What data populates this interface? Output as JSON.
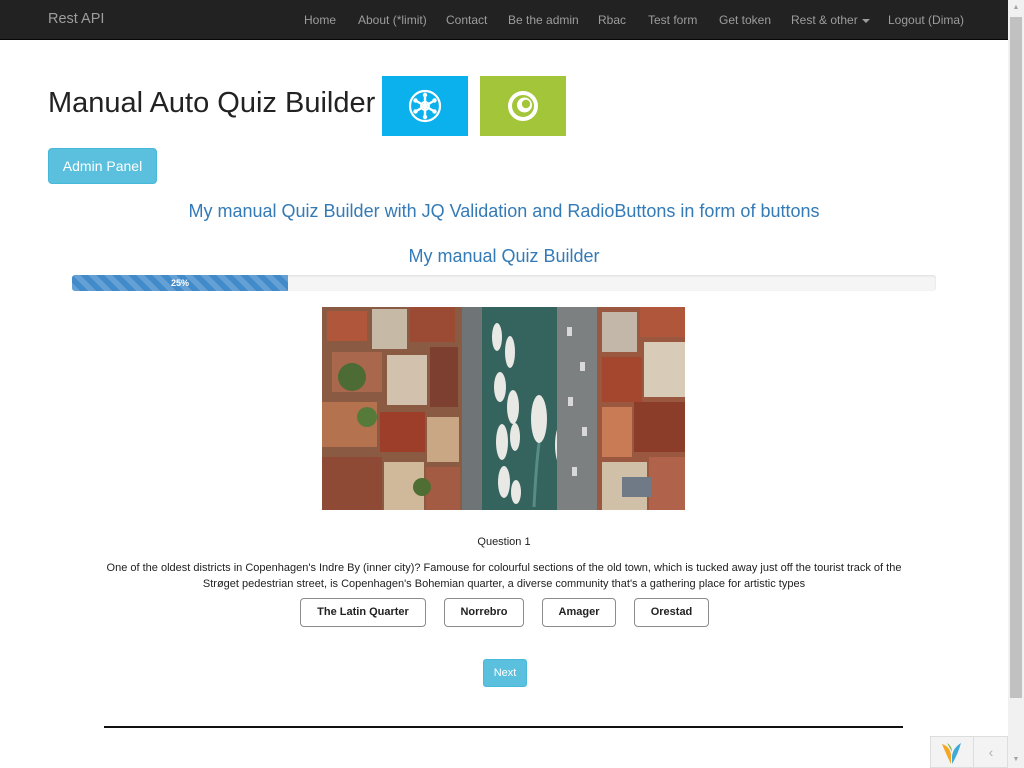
{
  "navbar": {
    "brand": "Rest API",
    "items": [
      "Home",
      "About (*limit)",
      "Contact",
      "Be the admin",
      "Rbac",
      "Test form",
      "Get token",
      "Rest & other",
      "Logout (Dima)"
    ]
  },
  "page": {
    "title": "Manual Auto Quiz Builder",
    "admin_button": "Admin Panel",
    "subtitle": "My manual Quiz Builder with JQ Validation and RadioButtons in form of buttons",
    "quiz_title": "My manual Quiz Builder"
  },
  "progress": {
    "label": "25%",
    "value": 0.25
  },
  "question": {
    "number_label": "Question 1",
    "text": "One of the oldest districts in Copenhagen's Indre By (inner city)? Famouse for colourful sections of the old town, which is tucked away just off the tourist track of the Strøget pedestrian street, is Copenhagen's Bohemian quarter, a diverse community that's a gathering place for artistic types",
    "answers": [
      "The Latin Quarter",
      "Norrebro",
      "Amager",
      "Orestad"
    ],
    "next_label": "Next"
  },
  "icons": {
    "tile_blue": "snowflake-icon",
    "tile_green": "circle-swirl-icon",
    "toolbar_logo": "yii-logo-icon",
    "toolbar_collapse": "chevron-left-icon"
  },
  "colors": {
    "navbar": "#222222",
    "link": "#337ab7",
    "info": "#5bc0de",
    "progress": "#428bca",
    "tile_blue": "#0ab1ec",
    "tile_green": "#a2c53a"
  }
}
